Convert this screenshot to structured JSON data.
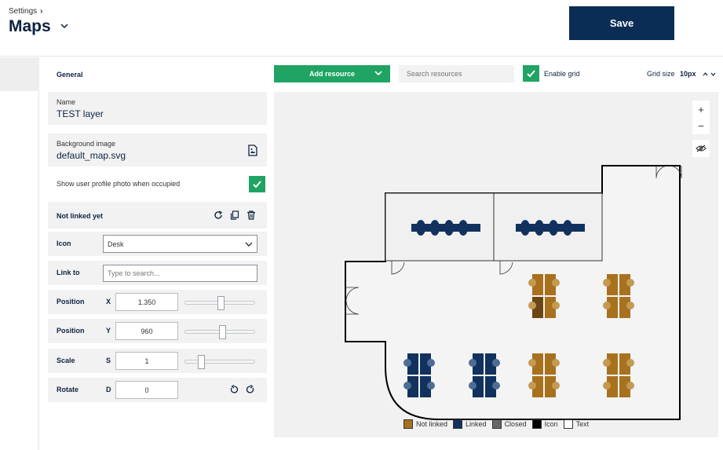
{
  "header": {
    "breadcrumb": "Settings",
    "title": "Maps",
    "save_label": "Save"
  },
  "panel": {
    "general_title": "General",
    "name_label": "Name",
    "name_value": "TEST layer",
    "background_label": "Background image",
    "background_value": "default_map.svg",
    "profile_photo_label": "Show user profile photo when occupied",
    "profile_photo_checked": true,
    "item_title": "Not linked yet",
    "icon_label": "Icon",
    "icon_value": "Desk",
    "link_label": "Link to",
    "link_placeholder": "Type to search...",
    "position_x": {
      "label": "Position",
      "axis": "X",
      "value": "1.350",
      "slider": 0.5
    },
    "position_y": {
      "label": "Position",
      "axis": "Y",
      "value": "960",
      "slider": 0.52
    },
    "scale": {
      "label": "Scale",
      "axis": "S",
      "value": "1",
      "slider": 0.2
    },
    "rotate": {
      "label": "Rotate",
      "axis": "D",
      "value": "0"
    }
  },
  "toolbar": {
    "add_resource_label": "Add resource",
    "search_placeholder": "Search resources",
    "enable_grid_label": "Enable grid",
    "enable_grid_checked": true,
    "grid_size_label": "Grid size",
    "grid_size_value": "10px"
  },
  "colors": {
    "primary": "#0b2d55",
    "accent": "#1fa463",
    "not_linked": "#a8711e",
    "linked": "#11325e",
    "closed": "#666666"
  },
  "legend": [
    {
      "label": "Not linked",
      "color": "#a8711e"
    },
    {
      "label": "Linked",
      "color": "#11325e"
    },
    {
      "label": "Closed",
      "color": "#666666"
    },
    {
      "label": "Icon",
      "color": "#000000"
    },
    {
      "label": "Text",
      "color": "#ffffff"
    }
  ],
  "icons": [
    "chevron-right-icon",
    "chevron-down-icon",
    "image-file-icon",
    "checkmark-icon",
    "refresh-icon",
    "copy-icon",
    "trash-icon",
    "rotate-left-icon",
    "rotate-right-icon",
    "zoom-in-icon",
    "zoom-out-icon",
    "eye-off-icon"
  ]
}
